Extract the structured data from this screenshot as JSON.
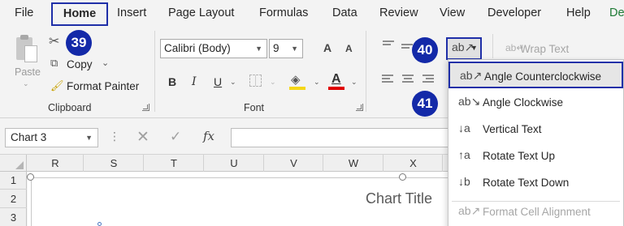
{
  "menu": {
    "tabs": [
      "File",
      "Home",
      "Insert",
      "Page Layout",
      "Formulas",
      "Data",
      "Review",
      "View",
      "Developer",
      "Help",
      "De"
    ]
  },
  "clipboard": {
    "paste_label": "Paste",
    "copy_label": "Copy",
    "format_painter_label": "Format Painter",
    "group_label": "Clipboard"
  },
  "font": {
    "name": "Calibri (Body)",
    "size": "9",
    "grow": "A",
    "shrink": "A",
    "bold": "B",
    "italic": "I",
    "underline": "U",
    "font_color_glyph": "A",
    "group_label": "Font",
    "fill_color": "#f5d716",
    "font_color": "#e00000"
  },
  "alignment": {
    "wrap_text_label": "Wrap Text"
  },
  "badges": {
    "b39": "39",
    "b40": "40",
    "b41": "41"
  },
  "formula_bar": {
    "name_box": "Chart 3",
    "fx": "fx"
  },
  "grid": {
    "columns": [
      "R",
      "S",
      "T",
      "U",
      "V",
      "W",
      "X"
    ],
    "rows": [
      "1",
      "2",
      "3"
    ]
  },
  "chart": {
    "title": "Chart Title"
  },
  "orientation_menu": {
    "items": [
      {
        "label": "Angle Counterclockwise",
        "icon": "angle-counterclockwise-icon",
        "selected": true
      },
      {
        "label": "Angle Clockwise",
        "icon": "angle-clockwise-icon"
      },
      {
        "label": "Vertical Text",
        "icon": "vertical-text-icon"
      },
      {
        "label": "Rotate Text Up",
        "icon": "rotate-text-up-icon"
      },
      {
        "label": "Rotate Text Down",
        "icon": "rotate-text-down-icon"
      },
      {
        "label": "Format Cell Alignment",
        "icon": "format-cell-alignment-icon",
        "disabled": true
      }
    ]
  },
  "colors": {
    "accent_highlight": "#1f2fa8",
    "badge": "#1329a8"
  }
}
